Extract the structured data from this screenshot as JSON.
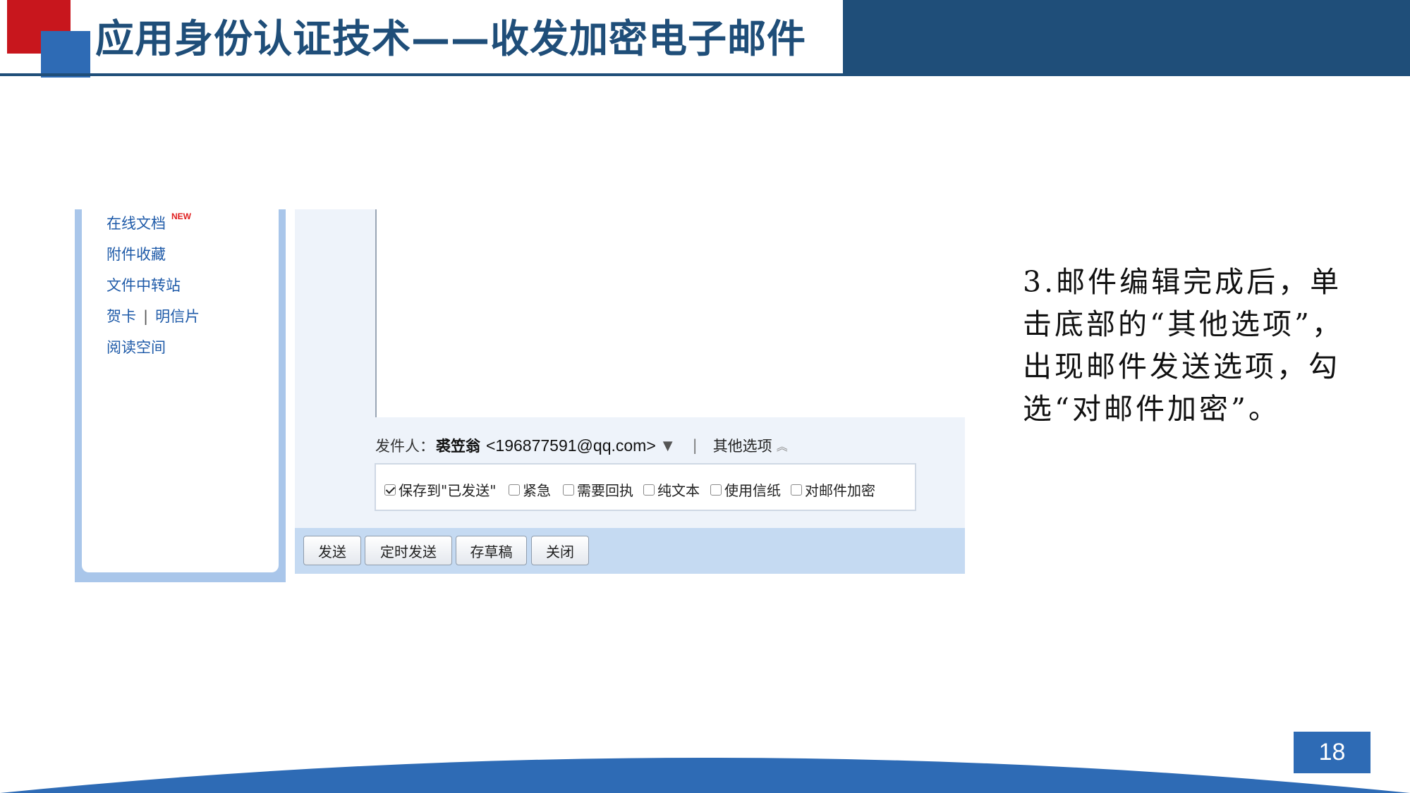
{
  "slide": {
    "title": "应用身份认证技术——收发加密电子邮件",
    "page_number": "18",
    "colors": {
      "dark_blue": "#1f4e79",
      "accent_blue": "#2e6bb5",
      "accent_red": "#c8161d"
    }
  },
  "mail_client": {
    "sidebar": {
      "items": [
        {
          "label": "在线文档",
          "badge": "NEW"
        },
        {
          "label": "附件收藏"
        },
        {
          "label": "文件中转站"
        },
        {
          "label": "贺卡",
          "second": "明信片",
          "separator": "|"
        },
        {
          "label": "阅读空间"
        }
      ]
    },
    "sender": {
      "label": "发件人：",
      "name": "裘笠翁",
      "email": "<196877591@qq.com>",
      "dropdown_icon": "triangle-down-icon",
      "separator": "|",
      "other_options": "其他选项",
      "expand_icon": "chevron-up-icon"
    },
    "options": [
      {
        "label": "保存到\"已发送\"",
        "checked": true
      },
      {
        "label": "紧急",
        "checked": false
      },
      {
        "label": "需要回执",
        "checked": false
      },
      {
        "label": "纯文本",
        "checked": false
      },
      {
        "label": "使用信纸",
        "checked": false
      },
      {
        "label": "对邮件加密",
        "checked": false
      }
    ],
    "buttons": {
      "send": "发送",
      "scheduled_send": "定时发送",
      "save_draft": "存草稿",
      "close": "关闭"
    }
  },
  "description": "3.邮件编辑完成后，单击底部的“其他选项”，出现邮件发送选项，勾选“对邮件加密”。"
}
